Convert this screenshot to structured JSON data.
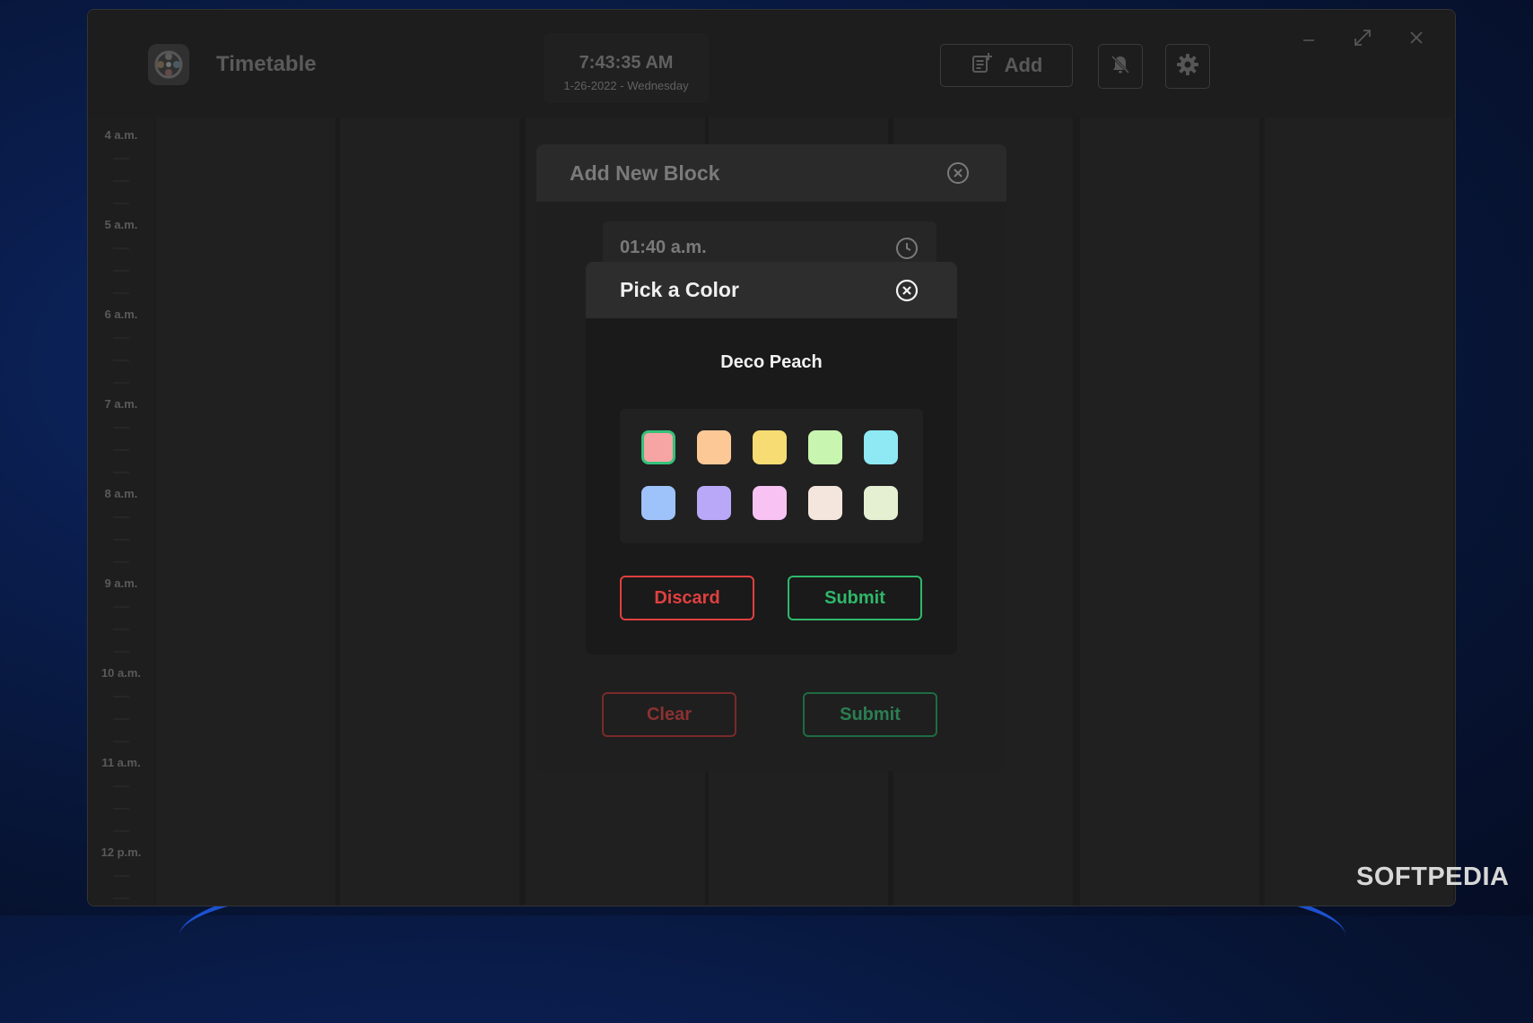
{
  "app": {
    "title": "Timetable"
  },
  "clock": {
    "time": "7:43:35 AM",
    "date": "1-26-2022 - Wednesday"
  },
  "toolbar": {
    "add_label": "Add"
  },
  "timeline": {
    "hours": [
      "4 a.m.",
      "5 a.m.",
      "6 a.m.",
      "7 a.m.",
      "8 a.m.",
      "9 a.m.",
      "10 a.m.",
      "11 a.m.",
      "12 p.m."
    ]
  },
  "add_block_dialog": {
    "title": "Add New Block",
    "time_value": "01:40 a.m.",
    "clear_label": "Clear",
    "submit_label": "Submit"
  },
  "color_picker": {
    "title": "Pick a Color",
    "selected_name": "Deco Peach",
    "selected_index": 0,
    "swatches": [
      "#f7a4a4",
      "#fcc896",
      "#f7dc73",
      "#c8f5b0",
      "#8ee9f5",
      "#9ec3fa",
      "#b8a8f7",
      "#f8c3f3",
      "#f4e6dc",
      "#e5efd2"
    ],
    "discard_label": "Discard",
    "submit_label": "Submit"
  },
  "colors": {
    "danger": "#e0403f",
    "success": "#2fb86b",
    "selected_outline": "#34c27a"
  },
  "watermark": "SOFTPEDIA"
}
